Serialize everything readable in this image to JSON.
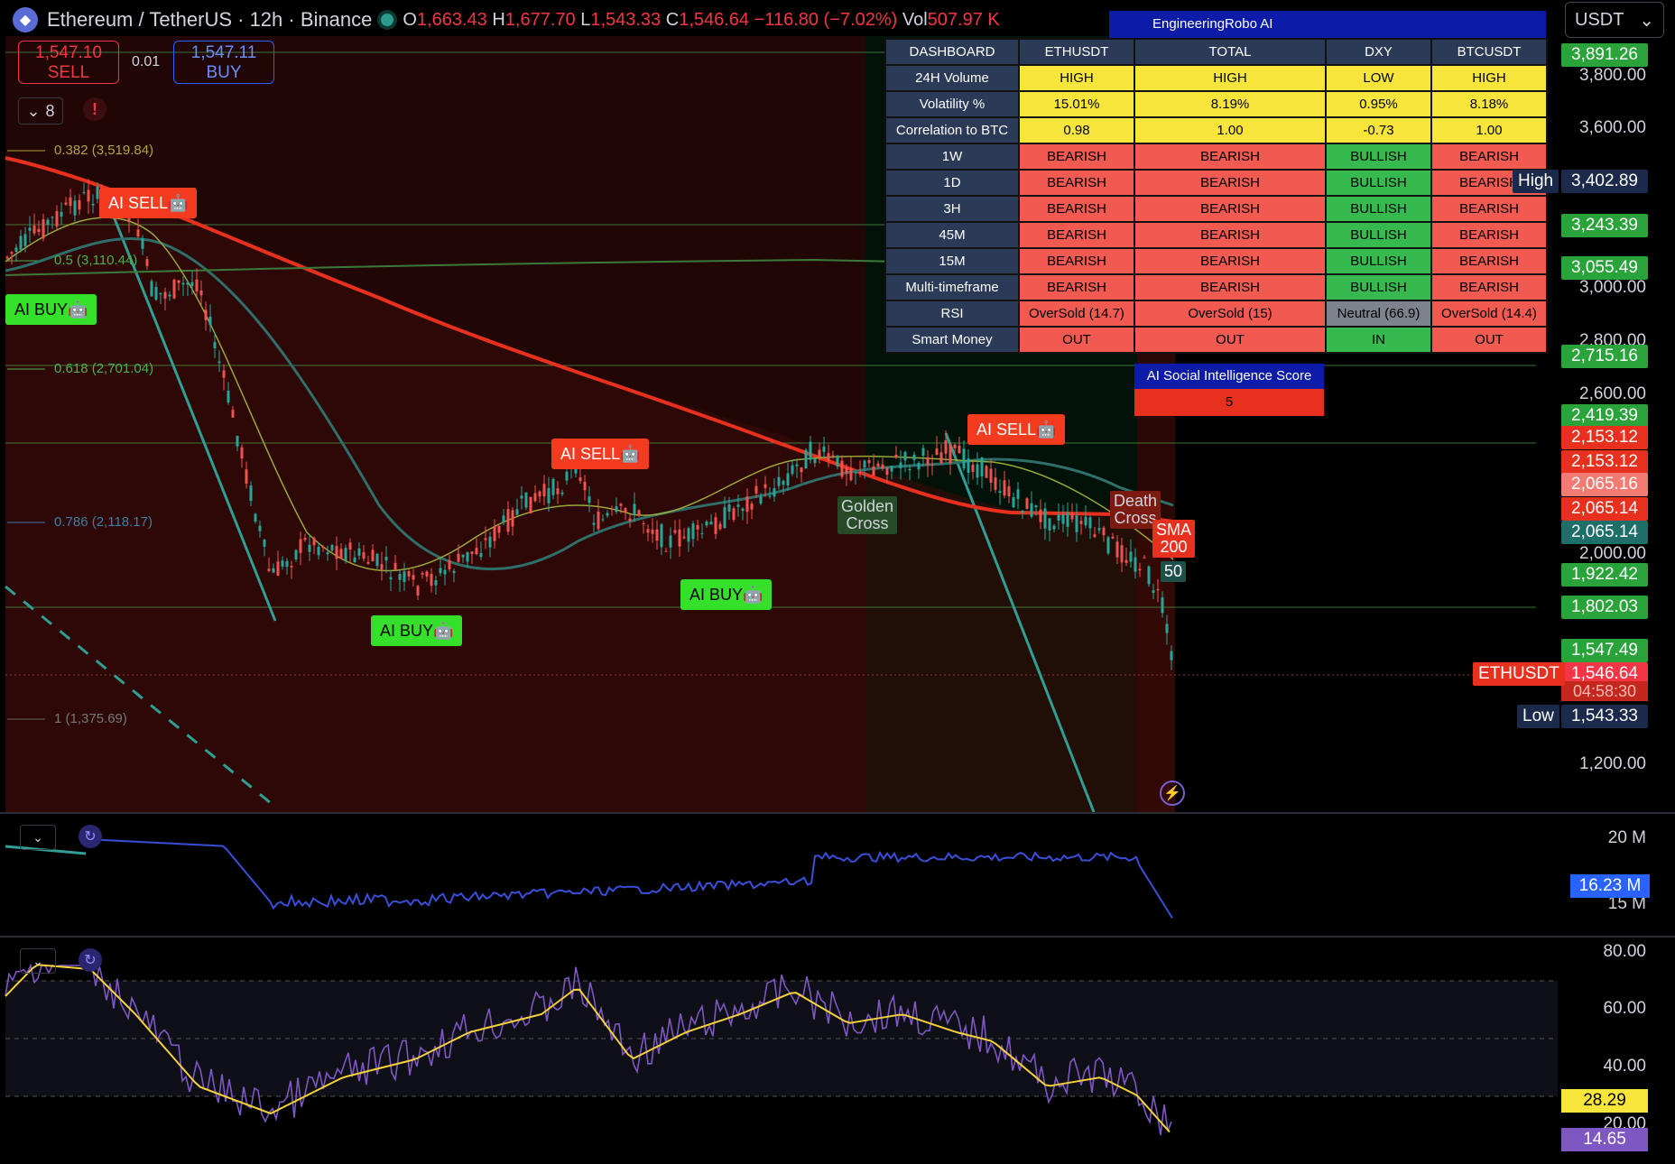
{
  "header": {
    "symbol_title": "Ethereum / TetherUS · 12h · Binance",
    "open_label": "O",
    "open": "1,663.43",
    "high_label": "H",
    "high": "1,677.70",
    "low_label": "L",
    "low": "1,543.33",
    "close_label": "C",
    "close": "1,546.64",
    "change": "−116.80 (−7.02%)",
    "vol_label": "Vol",
    "vol": "507.97 K"
  },
  "trade": {
    "sell_price": "1,547.10",
    "sell_label": "SELL",
    "spread": "0.01",
    "buy_price": "1,547.11",
    "buy_label": "BUY"
  },
  "indicators_count": "8",
  "currency_select": "USDT",
  "dashboard": {
    "title": "EngineeringRobo AI",
    "columns": [
      "DASHBOARD",
      "ETHUSDT",
      "TOTAL",
      "DXY",
      "BTCUSDT"
    ],
    "rows": [
      {
        "label": "24H Volume",
        "cells": [
          "HIGH",
          "HIGH",
          "LOW",
          "HIGH"
        ],
        "colors": [
          "y",
          "y",
          "y",
          "y"
        ]
      },
      {
        "label": "Volatility %",
        "cells": [
          "15.01%",
          "8.19%",
          "0.95%",
          "8.18%"
        ],
        "colors": [
          "y",
          "y",
          "y",
          "y"
        ]
      },
      {
        "label": "Correlation to BTC",
        "cells": [
          "0.98",
          "1.00",
          "-0.73",
          "1.00"
        ],
        "colors": [
          "y",
          "y",
          "y",
          "y"
        ]
      },
      {
        "label": "1W",
        "cells": [
          "BEARISH",
          "BEARISH",
          "BULLISH",
          "BEARISH"
        ],
        "colors": [
          "r",
          "r",
          "g",
          "r"
        ]
      },
      {
        "label": "1D",
        "cells": [
          "BEARISH",
          "BEARISH",
          "BULLISH",
          "BEARISH"
        ],
        "colors": [
          "r",
          "r",
          "g",
          "r"
        ]
      },
      {
        "label": "3H",
        "cells": [
          "BEARISH",
          "BEARISH",
          "BULLISH",
          "BEARISH"
        ],
        "colors": [
          "r",
          "r",
          "g",
          "r"
        ]
      },
      {
        "label": "45M",
        "cells": [
          "BEARISH",
          "BEARISH",
          "BULLISH",
          "BEARISH"
        ],
        "colors": [
          "r",
          "r",
          "g",
          "r"
        ]
      },
      {
        "label": "15M",
        "cells": [
          "BEARISH",
          "BEARISH",
          "BULLISH",
          "BEARISH"
        ],
        "colors": [
          "r",
          "r",
          "g",
          "r"
        ]
      },
      {
        "label": "Multi-timeframe",
        "cells": [
          "BEARISH",
          "BEARISH",
          "BULLISH",
          "BEARISH"
        ],
        "colors": [
          "r",
          "r",
          "g",
          "r"
        ]
      },
      {
        "label": "RSI",
        "cells": [
          "OverSold (14.7)",
          "OverSold (15)",
          "Neutral (66.9)",
          "OverSold (14.4)"
        ],
        "colors": [
          "r",
          "r",
          "gr",
          "r"
        ]
      },
      {
        "label": "Smart Money",
        "cells": [
          "OUT",
          "OUT",
          "IN",
          "OUT"
        ],
        "colors": [
          "r",
          "r",
          "g",
          "r"
        ]
      }
    ],
    "social_title": "AI Social Intelligence Score",
    "social_value": "5"
  },
  "price_axis": {
    "ticks": [
      "3,800.00",
      "3,600.00",
      "3,000.00",
      "2,800.00",
      "2,600.00",
      "2,000.00",
      "1,200.00"
    ],
    "labels": [
      {
        "text": "3,891.26",
        "color": "#2aa33a"
      },
      {
        "text": "3,402.89",
        "color": "#1b2a4a"
      },
      {
        "text": "3,243.39",
        "color": "#2aa33a"
      },
      {
        "text": "3,055.49",
        "color": "#2aa33a"
      },
      {
        "text": "2,715.16",
        "color": "#2aa33a"
      },
      {
        "text": "2,419.39",
        "color": "#2aa33a"
      },
      {
        "text": "2,153.12",
        "color": "#e8301f"
      },
      {
        "text": "2,153.12",
        "color": "#e8301f"
      },
      {
        "text": "2,065.16",
        "color": "#f27b73"
      },
      {
        "text": "2,065.14",
        "color": "#e8301f"
      },
      {
        "text": "2,065.14",
        "color": "#1e6e6a"
      },
      {
        "text": "1,922.42",
        "color": "#2aa33a"
      },
      {
        "text": "1,802.03",
        "color": "#2aa33a"
      },
      {
        "text": "1,547.49",
        "color": "#2aa33a"
      },
      {
        "text": "1,546.64",
        "color": "#f23645"
      },
      {
        "text": "1,543.33",
        "color": "#1b2a4a"
      }
    ],
    "countdown": "04:58:30",
    "high_tag": "High",
    "low_tag": "Low",
    "symbol_tag": "ETHUSDT"
  },
  "chart_labels": {
    "fib_382": "0.382 (3,519.84)",
    "fib_5": "0.5 (3,110.44)",
    "fib_618": "0.618 (2,701.04)",
    "fib_786": "0.786 (2,118.17)",
    "fib_1": "1 (1,375.69)",
    "ai_sell": "AI SELL🤖",
    "ai_buy": "AI BUY🤖",
    "golden_cross": "Golden\nCross",
    "death_cross": "Death\nCross",
    "sma200": "SMA\n200",
    "sma50": "50"
  },
  "volume_pane": {
    "ticks": [
      "20 M",
      "15 M"
    ],
    "current": "16.23 M"
  },
  "rsi_pane": {
    "ticks": [
      "80.00",
      "60.00",
      "40.00",
      "20.00"
    ],
    "ma_value": "28.29",
    "rsi_value": "14.65"
  }
}
